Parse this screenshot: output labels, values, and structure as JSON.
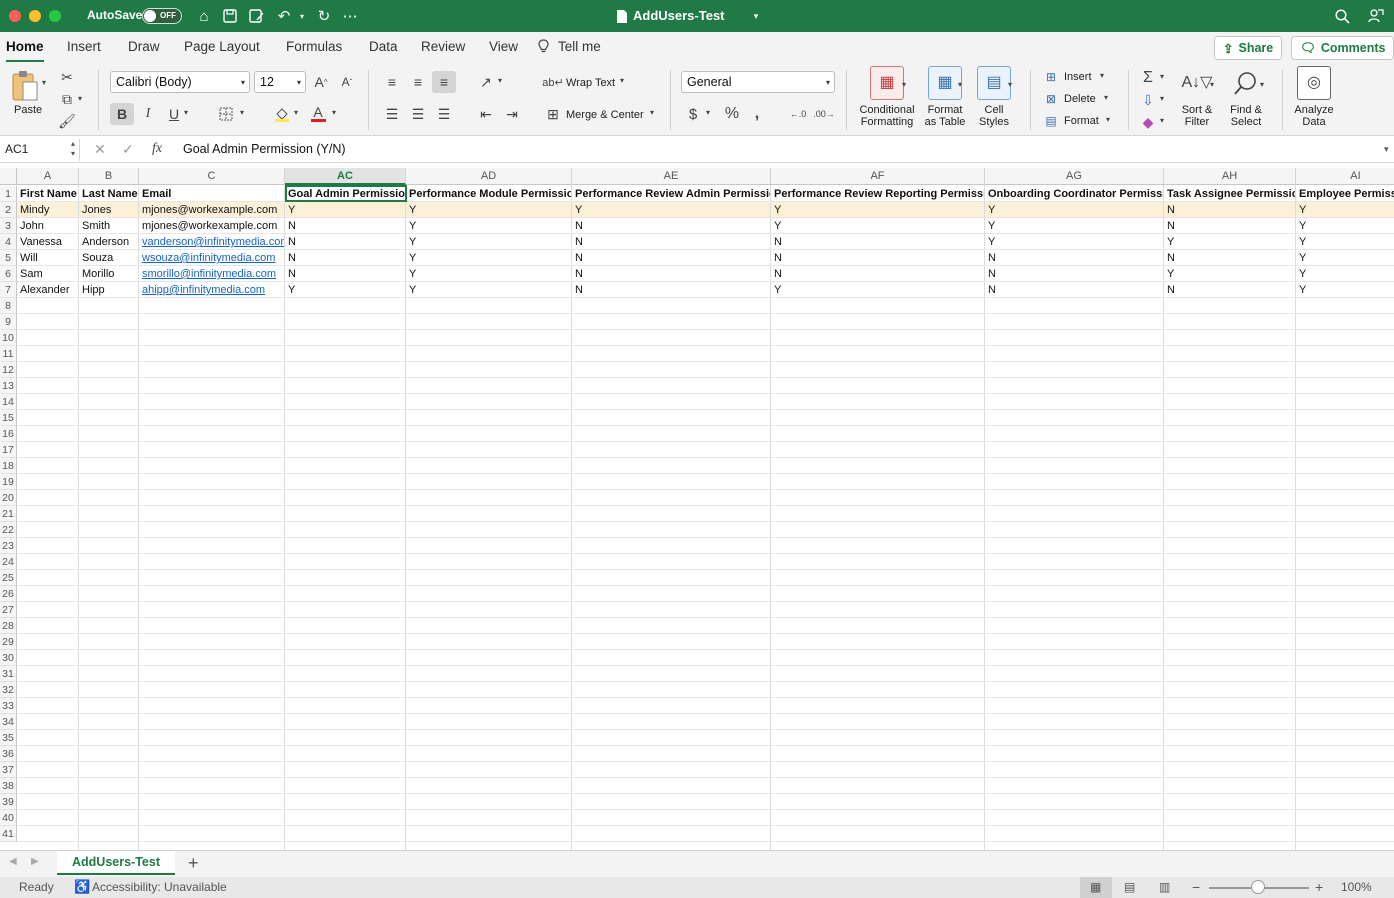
{
  "titlebar": {
    "autosave_label": "AutoSave",
    "autosave_state": "OFF",
    "doc_title": "AddUsers-Test"
  },
  "tabs": [
    "Home",
    "Insert",
    "Draw",
    "Page Layout",
    "Formulas",
    "Data",
    "Review",
    "View",
    "Tell me"
  ],
  "share_label": "Share",
  "comments_label": "Comments",
  "ribbon": {
    "paste": "Paste",
    "font_name": "Calibri (Body)",
    "font_size": "12",
    "wrap_text": "Wrap Text",
    "merge_center": "Merge & Center",
    "number_format": "General",
    "conditional_formatting": [
      "Conditional",
      "Formatting"
    ],
    "format_as_table": [
      "Format",
      "as Table"
    ],
    "cell_styles": [
      "Cell",
      "Styles"
    ],
    "insert": "Insert",
    "delete": "Delete",
    "format": "Format",
    "sort_filter": [
      "Sort &",
      "Filter"
    ],
    "find_select": [
      "Find &",
      "Select"
    ],
    "analyze_data": [
      "Analyze",
      "Data"
    ],
    "bold": "B",
    "italic": "I",
    "underline": "U"
  },
  "formula_bar": {
    "name_box": "AC1",
    "fx": "fx",
    "content": "Goal Admin Permission (Y/N)"
  },
  "columns": [
    "A",
    "B",
    "C",
    "AC",
    "AD",
    "AE",
    "AF",
    "AG",
    "AH",
    "AI"
  ],
  "row_count": 41,
  "rows": [
    [
      "First Name",
      "Last Name",
      "Email",
      "Goal Admin Permission",
      "Performance Module Permission",
      "Performance Review Admin Permission",
      "Performance Review Reporting Permission",
      "Onboarding Coordinator Permission",
      "Task Assignee Permission",
      "Employee Permissi"
    ],
    [
      "Mindy",
      "Jones",
      "mjones@workexample.com",
      "Y",
      "Y",
      "Y",
      "Y",
      "Y",
      "N",
      "Y"
    ],
    [
      "John",
      "Smith",
      "mjones@workexample.com",
      "N",
      "Y",
      "N",
      "Y",
      "Y",
      "N",
      "Y"
    ],
    [
      "Vanessa",
      "Anderson",
      "vanderson@infinitymedia.com",
      "N",
      "Y",
      "N",
      "N",
      "Y",
      "Y",
      "Y"
    ],
    [
      "Will",
      "Souza",
      "wsouza@infinitymedia.com",
      "N",
      "Y",
      "N",
      "N",
      "N",
      "N",
      "Y"
    ],
    [
      "Sam",
      "Morillo",
      "smorillo@infinitymedia.com",
      "N",
      "Y",
      "N",
      "N",
      "N",
      "Y",
      "Y"
    ],
    [
      "Alexander",
      "Hipp",
      "ahipp@infinitymedia.com",
      "Y",
      "Y",
      "N",
      "Y",
      "N",
      "N",
      "Y"
    ]
  ],
  "link_rows": [
    3,
    4,
    5,
    6
  ],
  "sheet_tab": "AddUsers-Test",
  "add_sheet": "+",
  "status": {
    "ready": "Ready",
    "accessibility": "Accessibility: Unavailable",
    "zoom": "100%"
  },
  "colors": {
    "accent": "#1f7a45",
    "row_highlight": "#fdf0d8",
    "link": "#1563c3"
  }
}
